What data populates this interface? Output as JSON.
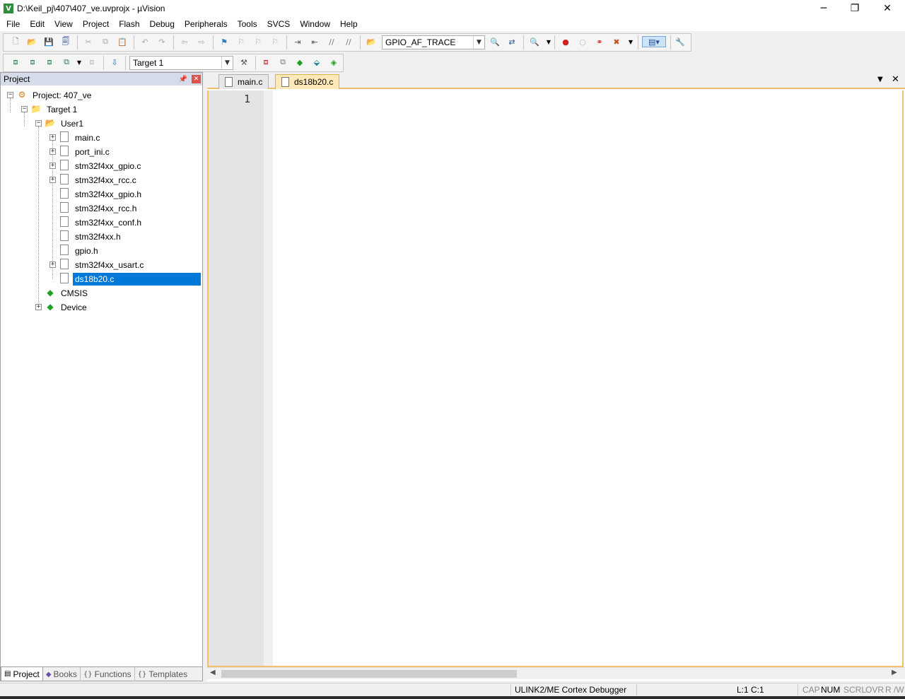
{
  "window": {
    "title": "D:\\Keil_pj\\407\\407_ve.uvprojx - µVision",
    "app_icon_letter": "V",
    "minimize": "─",
    "maximize": "❐",
    "close": "✕"
  },
  "menu": [
    "File",
    "Edit",
    "View",
    "Project",
    "Flash",
    "Debug",
    "Peripherals",
    "Tools",
    "SVCS",
    "Window",
    "Help"
  ],
  "toolbar1": {
    "find_combo_value": "GPIO_AF_TRACE"
  },
  "toolbar2": {
    "target_combo_value": "Target 1"
  },
  "project_panel": {
    "title": "Project",
    "tree": {
      "root": "Project: 407_ve",
      "target": "Target 1",
      "group": "User1",
      "files": [
        "main.c",
        "port_ini.c",
        "stm32f4xx_gpio.c",
        "stm32f4xx_rcc.c",
        "stm32f4xx_gpio.h",
        "stm32f4xx_rcc.h",
        "stm32f4xx_conf.h",
        "stm32f4xx.h",
        "gpio.h",
        "stm32f4xx_usart.c",
        "ds18b20.c"
      ],
      "cmsis": "CMSIS",
      "device": "Device"
    },
    "tabs": [
      "Project",
      "Books",
      "Functions",
      "Templates"
    ],
    "tab_icons": [
      "▤",
      "◆",
      "{}",
      "{}"
    ]
  },
  "editor": {
    "tabs": [
      "main.c",
      "ds18b20.c"
    ],
    "active_tab": "ds18b20.c",
    "line_numbers": [
      "1"
    ]
  },
  "status": {
    "debugger": "ULINK2/ME Cortex Debugger",
    "position": "L:1 C:1",
    "cap": "CAP",
    "num": "NUM",
    "scrl": "SCRL",
    "ovr": "OVR",
    "rw": "R /W"
  },
  "colors": {
    "selection": "#0078d7",
    "active_tab": "#fde9b8",
    "editor_border": "#f3c06a",
    "panel_header": "#d6dbe9"
  }
}
